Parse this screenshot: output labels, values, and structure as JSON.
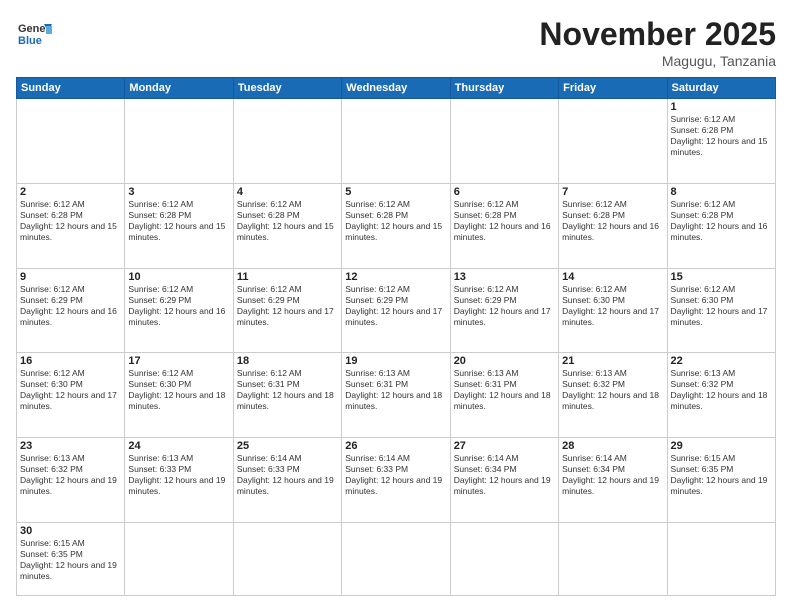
{
  "logo": {
    "text_general": "General",
    "text_blue": "Blue"
  },
  "header": {
    "month_year": "November 2025",
    "location": "Magugu, Tanzania"
  },
  "days_of_week": [
    "Sunday",
    "Monday",
    "Tuesday",
    "Wednesday",
    "Thursday",
    "Friday",
    "Saturday"
  ],
  "weeks": [
    [
      {
        "day": "",
        "info": ""
      },
      {
        "day": "",
        "info": ""
      },
      {
        "day": "",
        "info": ""
      },
      {
        "day": "",
        "info": ""
      },
      {
        "day": "",
        "info": ""
      },
      {
        "day": "",
        "info": ""
      },
      {
        "day": "1",
        "info": "Sunrise: 6:12 AM\nSunset: 6:28 PM\nDaylight: 12 hours and 15 minutes."
      }
    ],
    [
      {
        "day": "2",
        "info": "Sunrise: 6:12 AM\nSunset: 6:28 PM\nDaylight: 12 hours and 15 minutes."
      },
      {
        "day": "3",
        "info": "Sunrise: 6:12 AM\nSunset: 6:28 PM\nDaylight: 12 hours and 15 minutes."
      },
      {
        "day": "4",
        "info": "Sunrise: 6:12 AM\nSunset: 6:28 PM\nDaylight: 12 hours and 15 minutes."
      },
      {
        "day": "5",
        "info": "Sunrise: 6:12 AM\nSunset: 6:28 PM\nDaylight: 12 hours and 15 minutes."
      },
      {
        "day": "6",
        "info": "Sunrise: 6:12 AM\nSunset: 6:28 PM\nDaylight: 12 hours and 16 minutes."
      },
      {
        "day": "7",
        "info": "Sunrise: 6:12 AM\nSunset: 6:28 PM\nDaylight: 12 hours and 16 minutes."
      },
      {
        "day": "8",
        "info": "Sunrise: 6:12 AM\nSunset: 6:28 PM\nDaylight: 12 hours and 16 minutes."
      }
    ],
    [
      {
        "day": "9",
        "info": "Sunrise: 6:12 AM\nSunset: 6:29 PM\nDaylight: 12 hours and 16 minutes."
      },
      {
        "day": "10",
        "info": "Sunrise: 6:12 AM\nSunset: 6:29 PM\nDaylight: 12 hours and 16 minutes."
      },
      {
        "day": "11",
        "info": "Sunrise: 6:12 AM\nSunset: 6:29 PM\nDaylight: 12 hours and 17 minutes."
      },
      {
        "day": "12",
        "info": "Sunrise: 6:12 AM\nSunset: 6:29 PM\nDaylight: 12 hours and 17 minutes."
      },
      {
        "day": "13",
        "info": "Sunrise: 6:12 AM\nSunset: 6:29 PM\nDaylight: 12 hours and 17 minutes."
      },
      {
        "day": "14",
        "info": "Sunrise: 6:12 AM\nSunset: 6:30 PM\nDaylight: 12 hours and 17 minutes."
      },
      {
        "day": "15",
        "info": "Sunrise: 6:12 AM\nSunset: 6:30 PM\nDaylight: 12 hours and 17 minutes."
      }
    ],
    [
      {
        "day": "16",
        "info": "Sunrise: 6:12 AM\nSunset: 6:30 PM\nDaylight: 12 hours and 17 minutes."
      },
      {
        "day": "17",
        "info": "Sunrise: 6:12 AM\nSunset: 6:30 PM\nDaylight: 12 hours and 18 minutes."
      },
      {
        "day": "18",
        "info": "Sunrise: 6:12 AM\nSunset: 6:31 PM\nDaylight: 12 hours and 18 minutes."
      },
      {
        "day": "19",
        "info": "Sunrise: 6:13 AM\nSunset: 6:31 PM\nDaylight: 12 hours and 18 minutes."
      },
      {
        "day": "20",
        "info": "Sunrise: 6:13 AM\nSunset: 6:31 PM\nDaylight: 12 hours and 18 minutes."
      },
      {
        "day": "21",
        "info": "Sunrise: 6:13 AM\nSunset: 6:32 PM\nDaylight: 12 hours and 18 minutes."
      },
      {
        "day": "22",
        "info": "Sunrise: 6:13 AM\nSunset: 6:32 PM\nDaylight: 12 hours and 18 minutes."
      }
    ],
    [
      {
        "day": "23",
        "info": "Sunrise: 6:13 AM\nSunset: 6:32 PM\nDaylight: 12 hours and 19 minutes."
      },
      {
        "day": "24",
        "info": "Sunrise: 6:13 AM\nSunset: 6:33 PM\nDaylight: 12 hours and 19 minutes."
      },
      {
        "day": "25",
        "info": "Sunrise: 6:14 AM\nSunset: 6:33 PM\nDaylight: 12 hours and 19 minutes."
      },
      {
        "day": "26",
        "info": "Sunrise: 6:14 AM\nSunset: 6:33 PM\nDaylight: 12 hours and 19 minutes."
      },
      {
        "day": "27",
        "info": "Sunrise: 6:14 AM\nSunset: 6:34 PM\nDaylight: 12 hours and 19 minutes."
      },
      {
        "day": "28",
        "info": "Sunrise: 6:14 AM\nSunset: 6:34 PM\nDaylight: 12 hours and 19 minutes."
      },
      {
        "day": "29",
        "info": "Sunrise: 6:15 AM\nSunset: 6:35 PM\nDaylight: 12 hours and 19 minutes."
      }
    ],
    [
      {
        "day": "30",
        "info": "Sunrise: 6:15 AM\nSunset: 6:35 PM\nDaylight: 12 hours and 19 minutes."
      },
      {
        "day": "",
        "info": ""
      },
      {
        "day": "",
        "info": ""
      },
      {
        "day": "",
        "info": ""
      },
      {
        "day": "",
        "info": ""
      },
      {
        "day": "",
        "info": ""
      },
      {
        "day": "",
        "info": ""
      }
    ]
  ]
}
